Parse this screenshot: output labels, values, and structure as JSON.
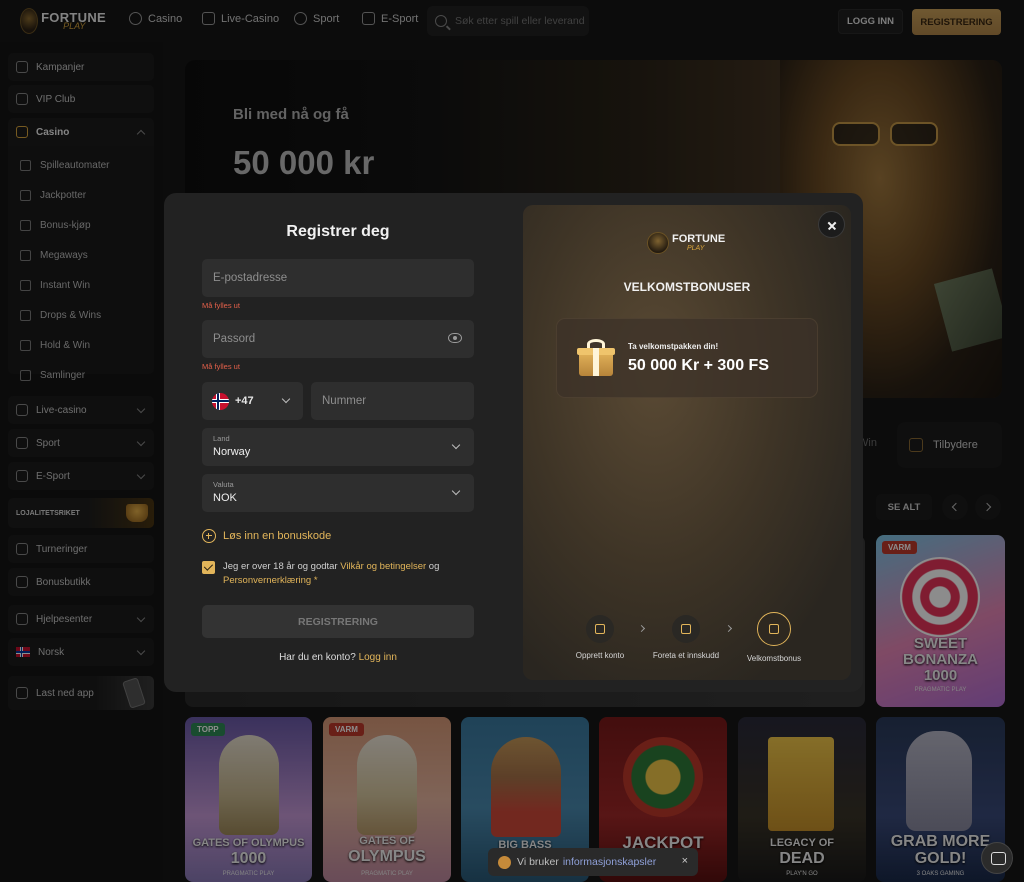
{
  "topbar": {
    "logo_line1": "FORTUNE",
    "logo_line2": "PLAY",
    "nav": [
      "Casino",
      "Live-Casino",
      "Sport",
      "E-Sport"
    ],
    "search_placeholder": "Søk etter spill eller leverandør",
    "login_label": "LOGG INN",
    "register_label": "REGISTRERING"
  },
  "sidebar": {
    "top_items": [
      "Kampanjer",
      "VIP Club"
    ],
    "casino_label": "Casino",
    "casino_sub": [
      "Spilleautomater",
      "Jackpotter",
      "Bonus-kjøp",
      "Megaways",
      "Instant Win",
      "Drops & Wins",
      "Hold & Win",
      "Samlinger"
    ],
    "groups": [
      "Live-casino",
      "Sport",
      "E-Sport"
    ],
    "loyalty_label": "LOJALITETSRIKET",
    "extras": [
      "Turneringer",
      "Bonusbutikk"
    ],
    "help_label": "Hjelpesenter",
    "language_label": "Norsk",
    "app_label": "Last ned app"
  },
  "hero": {
    "subtitle": "Bli med nå og få",
    "amount": "50 000 kr"
  },
  "main": {
    "tab_win_partial": "Win",
    "tab_providers": "Tilbydere",
    "see_all": "SE ALT"
  },
  "tiles_top": [
    {
      "badge": "VARM",
      "title1": "SWEET",
      "title2": "BONANZA",
      "title3": "1000",
      "provider": "PRAGMATIC PLAY"
    }
  ],
  "tiles_bottom": [
    {
      "badge": "TOPP",
      "title1": "GATES OF OLYMPUS",
      "title2": "1000",
      "provider": "PRAGMATIC PLAY"
    },
    {
      "badge": "VARM",
      "title1": "GATES OF",
      "title2": "OLYMPUS",
      "provider": "PRAGMATIC PLAY"
    },
    {
      "badge": "",
      "title1": "BIG BASS",
      "title2": "",
      "provider": ""
    },
    {
      "badge": "",
      "title1": "JACKPOT",
      "title2": "",
      "provider": ""
    },
    {
      "badge": "",
      "title1": "LEGACY OF",
      "title2": "DEAD",
      "provider": "PLAY'N GO"
    },
    {
      "badge": "",
      "title1": "GRAB MORE",
      "title2": "GOLD!",
      "provider": "3 OAKS GAMING"
    }
  ],
  "modal": {
    "title": "Registrer deg",
    "email_placeholder": "E-postadresse",
    "required_msg": "Må fylles ut",
    "password_placeholder": "Passord",
    "phone_code": "+47",
    "phone_placeholder": "Nummer",
    "country_label": "Land",
    "country_value": "Norway",
    "currency_label": "Valuta",
    "currency_value": "NOK",
    "bonus_code_label": "Løs inn en bonuskode",
    "consent_pre": "Jeg er over 18 år og godtar",
    "consent_terms": "Vilkår og betingelser",
    "consent_and": "og",
    "consent_privacy": "Personvernerklæring",
    "consent_required_mark": "*",
    "submit_label": "REGISTRERING",
    "have_account_text": "Har du en konto?",
    "login_link": "Logg inn"
  },
  "promo": {
    "logo_line1": "FORTUNE",
    "logo_line2": "PLAY",
    "heading": "VELKOMSTBONUSER",
    "offer_small": "Ta velkomstpakken din!",
    "offer_big": "50 000 Kr + 300 FS",
    "steps": [
      "Opprett konto",
      "Foreta et innskudd",
      "Velkomstbonus"
    ]
  },
  "cookie": {
    "text": "Vi bruker",
    "link": "informasjonskapsler",
    "close": "×"
  },
  "colors": {
    "accent": "#e2b55a",
    "register_btn": "#c19651",
    "error": "#e4604a",
    "modal_bg": "#222222"
  }
}
